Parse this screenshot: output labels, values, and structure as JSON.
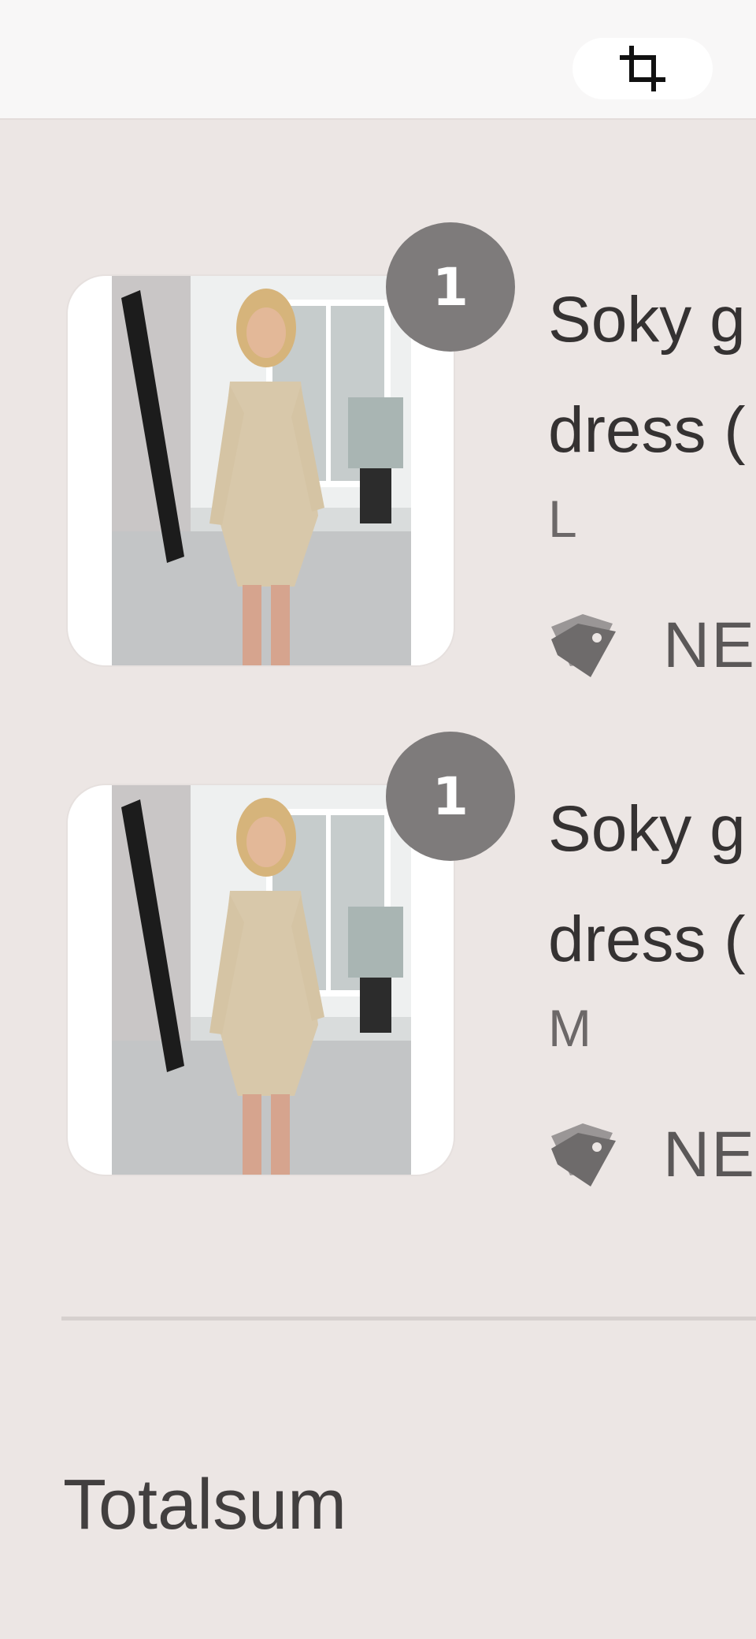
{
  "toolbar": {
    "crop_icon": "crop-icon"
  },
  "cart": {
    "items": [
      {
        "quantity": "1",
        "name": "Soky g dress (",
        "variant": "L",
        "discount_code": "NEW",
        "image_alt": "dress-photo"
      },
      {
        "quantity": "1",
        "name": "Soky g dress (",
        "variant": "M",
        "discount_code": "NEW",
        "image_alt": "dress-photo"
      }
    ]
  },
  "summary": {
    "total_label": "Totalsum"
  },
  "colors": {
    "background": "#ece6e4",
    "badge": "#7e7b7b",
    "text": "#353232"
  }
}
